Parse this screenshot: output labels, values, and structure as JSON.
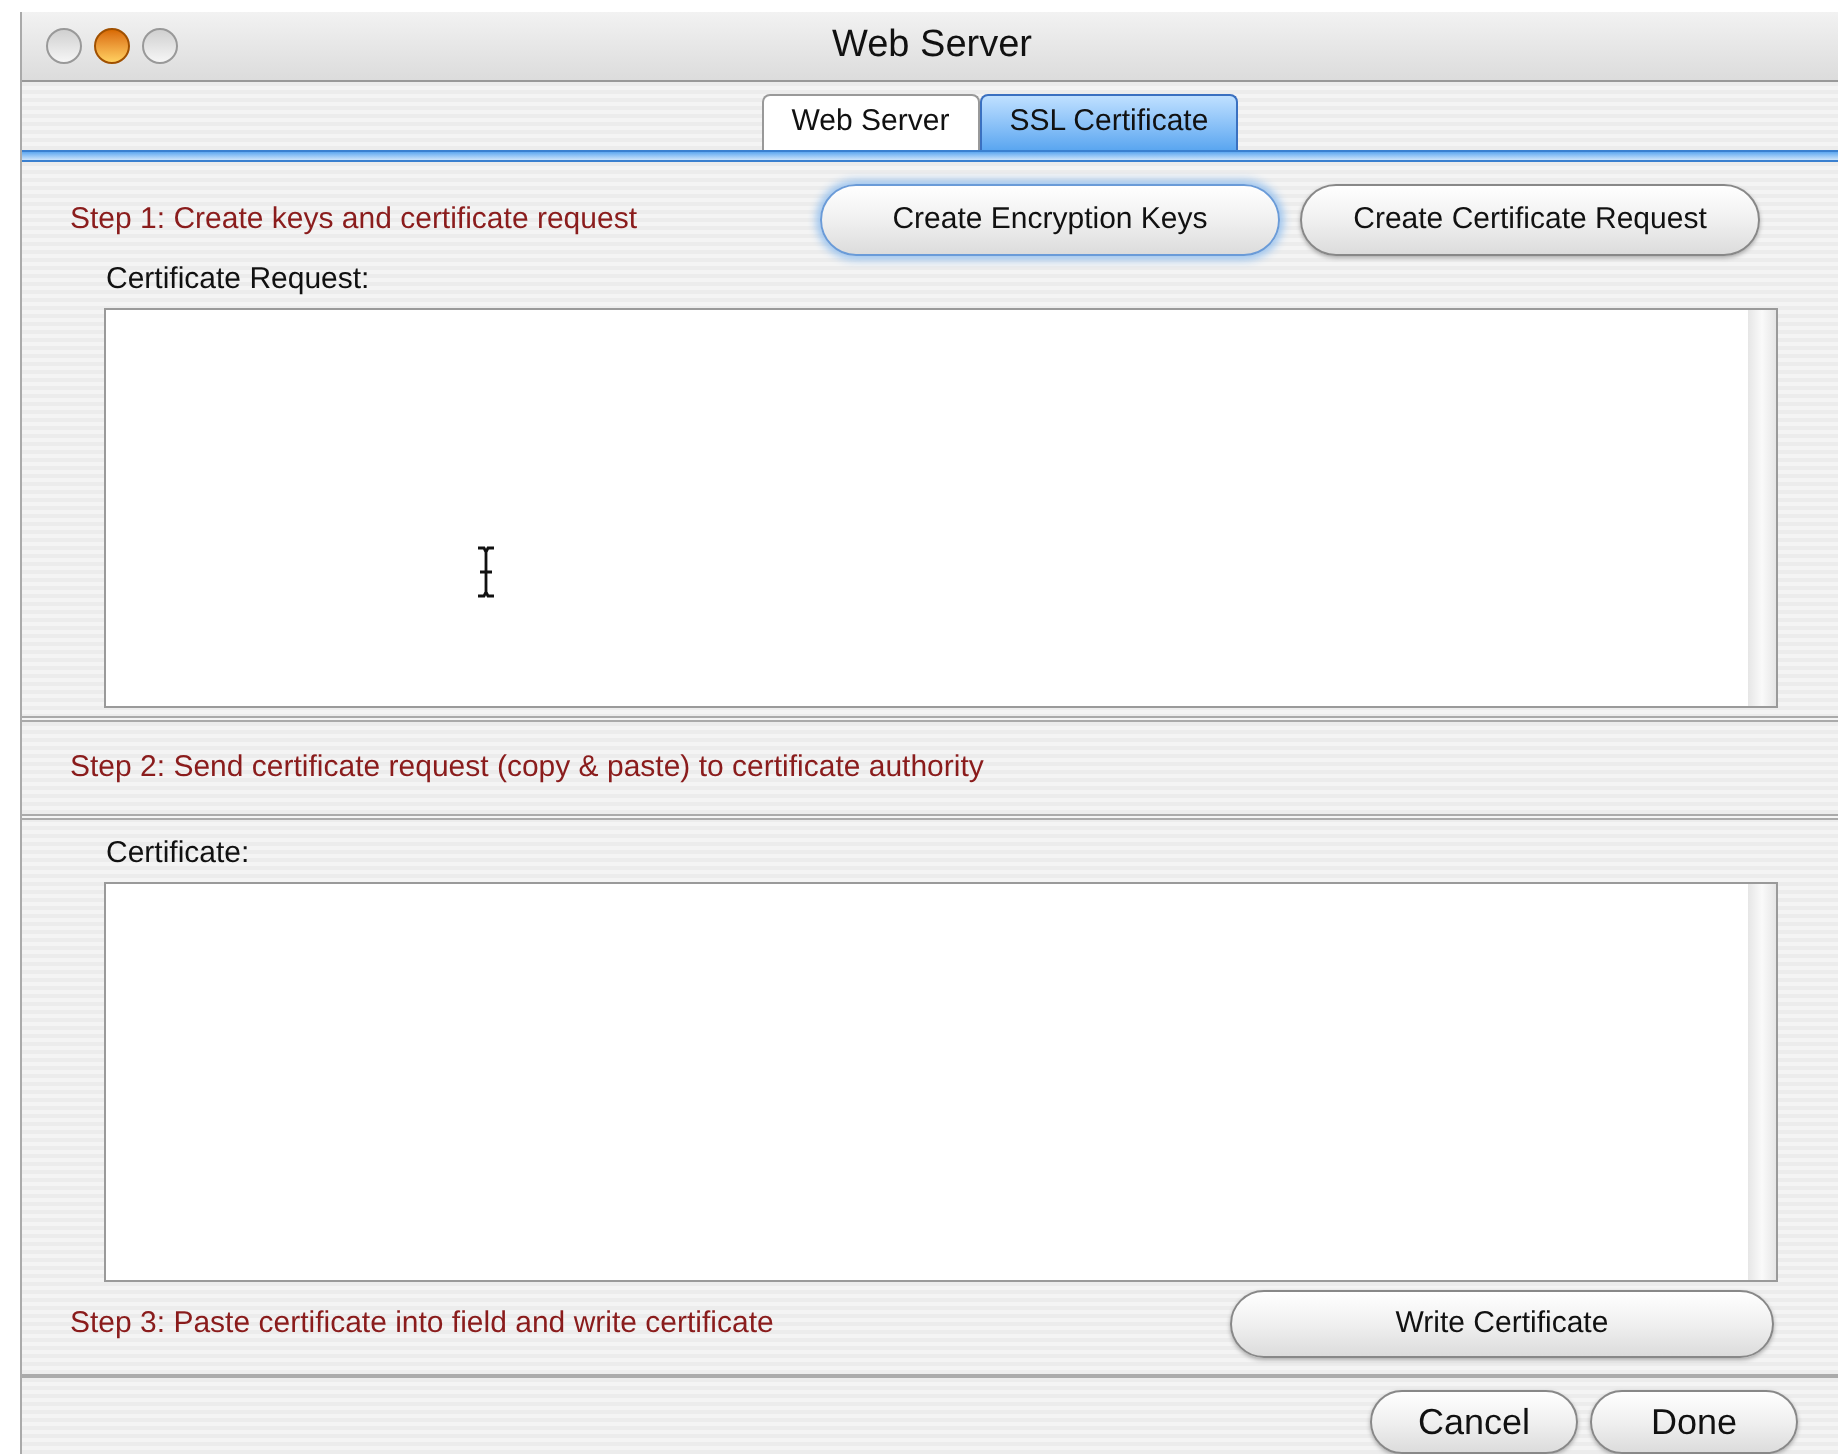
{
  "window": {
    "title": "Web Server"
  },
  "tabs": [
    {
      "label": "Web Server",
      "selected": false
    },
    {
      "label": "SSL Certificate",
      "selected": true
    }
  ],
  "step1": {
    "text": "Step 1: Create keys and certificate request",
    "buttons": [
      {
        "label": "Create Encryption Keys",
        "default": true
      },
      {
        "label": "Create Certificate Request",
        "default": false
      }
    ],
    "field_label": "Certificate Request:"
  },
  "step2": {
    "text": "Step 2: Send certificate request (copy & paste) to certificate authority"
  },
  "step3": {
    "field_label": "Certificate:",
    "text": "Step 3: Paste certificate into field and write certificate",
    "button": "Write Certificate"
  },
  "footer_buttons": [
    "Cancel",
    "Done"
  ]
}
